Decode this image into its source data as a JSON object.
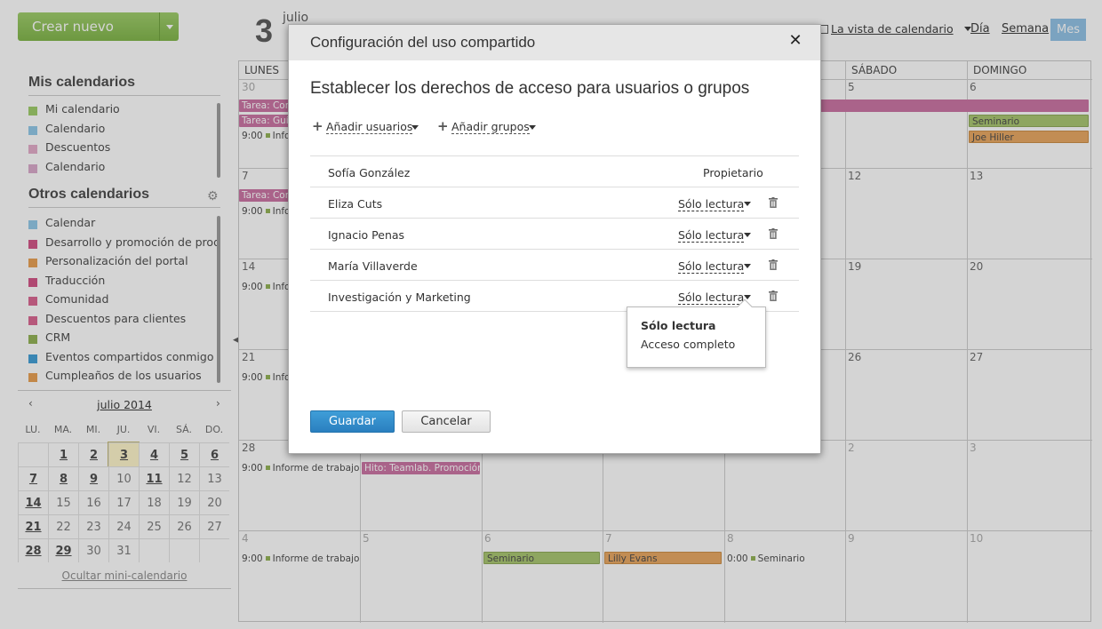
{
  "create_button": {
    "label": "Crear nuevo"
  },
  "header": {
    "day": "3",
    "month": "julio",
    "view_selector": "La vista de calendario",
    "views": [
      "Día",
      "Semana",
      "Mes"
    ]
  },
  "sidebar": {
    "my_title": "Mis calendarios",
    "my_calendars": [
      {
        "label": "Mi calendario",
        "color": "#9ccc65"
      },
      {
        "label": "Calendario",
        "color": "#8ec7e8"
      },
      {
        "label": "Descuentos",
        "color": "#e3a9c8"
      },
      {
        "label": "Calendario",
        "color": "#d9a7c9"
      }
    ],
    "other_title": "Otros calendarios",
    "other_calendars": [
      {
        "label": "Calendar",
        "color": "#8ec7e8"
      },
      {
        "label": "Desarrollo y promoción de prod…",
        "color": "#d14e82"
      },
      {
        "label": "Personalización del portal",
        "color": "#e89d4c"
      },
      {
        "label": "Traducción",
        "color": "#d14e82"
      },
      {
        "label": "Comunidad",
        "color": "#d9608e"
      },
      {
        "label": "Descuentos para clientes",
        "color": "#d9608e"
      },
      {
        "label": "CRM",
        "color": "#8fb04f"
      },
      {
        "label": "Eventos compartidos conmigo",
        "color": "#3a9bd5"
      },
      {
        "label": "Cumpleaños de los usuarios",
        "color": "#e89d4c"
      }
    ]
  },
  "mini_calendar": {
    "title": "julio 2014",
    "weekdays": [
      "LU.",
      "MA.",
      "MI.",
      "JU.",
      "VI.",
      "SÁ.",
      "DO."
    ],
    "weeks": [
      [
        "",
        "1",
        "2",
        "3",
        "4",
        "5",
        "6"
      ],
      [
        "7",
        "8",
        "9",
        "10",
        "11",
        "12",
        "13"
      ],
      [
        "14",
        "15",
        "16",
        "17",
        "18",
        "19",
        "20"
      ],
      [
        "21",
        "22",
        "23",
        "24",
        "25",
        "26",
        "27"
      ],
      [
        "28",
        "29",
        "30",
        "31",
        "",
        "",
        ""
      ]
    ],
    "hide_label": "Ocultar mini-calendario"
  },
  "month_grid": {
    "weekdays": [
      "LUNES",
      "",
      "",
      "",
      "",
      "SÁBADO",
      "DOMINGO"
    ],
    "day_numbers": [
      [
        "30",
        "",
        "",
        "",
        "",
        "5",
        "6"
      ],
      [
        "7",
        "",
        "",
        "",
        "",
        "12",
        "13"
      ],
      [
        "14",
        "",
        "",
        "",
        "",
        "19",
        "20"
      ],
      [
        "21",
        "",
        "",
        "",
        "",
        "26",
        "27"
      ],
      [
        "28",
        "",
        "",
        "",
        "",
        "2",
        "3"
      ],
      [
        "4",
        "5",
        "6",
        "7",
        "8",
        "9",
        "10"
      ]
    ],
    "events": {
      "task_com": "Tarea: Com",
      "task_guia": "Tarea: Guía",
      "info": "Info",
      "seminario": "Seminario",
      "joe": "Joe Hiller",
      "informe": "Informe de trabajo",
      "hito": "Hito: Teamlab. Promoción",
      "lilly": "Lilly Evans",
      "time_9": "9:00",
      "time_0": "0:00"
    }
  },
  "modal": {
    "title": "Configuración del uso compartido",
    "subtitle": "Establecer los derechos de acceso para usuarios o grupos",
    "add_users": "Añadir usuarios",
    "add_groups": "Añadir grupos",
    "rows": [
      {
        "name": "Sofía González",
        "access": "Propietario",
        "owner": true
      },
      {
        "name": "Eliza Cuts",
        "access": "Sólo lectura",
        "owner": false
      },
      {
        "name": "Ignacio Penas",
        "access": "Sólo lectura",
        "owner": false
      },
      {
        "name": "María Villaverde",
        "access": "Sólo lectura",
        "owner": false
      },
      {
        "name": "Investigación y Marketing",
        "access": "Sólo lectura",
        "owner": false
      }
    ],
    "dropdown_options": [
      "Sólo lectura",
      "Acceso completo"
    ],
    "save": "Guardar",
    "cancel": "Cancelar"
  }
}
